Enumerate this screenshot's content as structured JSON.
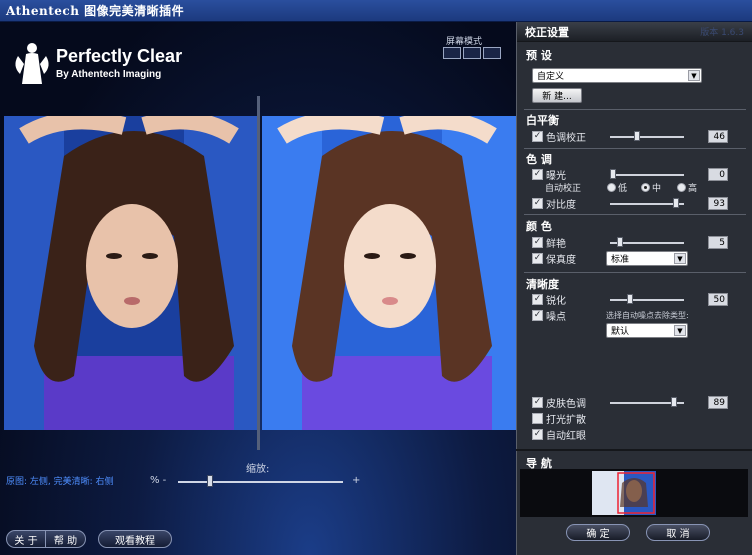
{
  "window": {
    "title": "Athentech  图像完美清晰插件"
  },
  "logo": {
    "brand": "Perfectly Clear",
    "sub": "By Athentech Imaging"
  },
  "screen_mode": {
    "label": "屏幕模式"
  },
  "viewer": {
    "zoom_label": "缩放:",
    "legend": "原图: 左侧, 完美清晰: 右侧",
    "pct_label": "% -",
    "plus_label": "+",
    "zoom_level": 0.18
  },
  "bottom": {
    "about": "关 于",
    "help": "帮 助",
    "tutorial": "观看教程"
  },
  "panel": {
    "header": "校正设置",
    "version": "版本 1.6.3",
    "preset": {
      "title": "预 设",
      "selected": "自定义",
      "new_button": "新 建..."
    },
    "white_balance": {
      "title": "白平衡",
      "color_correction": "色调校正",
      "value": "46",
      "level": 0.35
    },
    "tone": {
      "title": "色 调",
      "exposure": "曝光",
      "exposure_value": "0",
      "exposure_level": 0.0,
      "auto_label": "自动校正",
      "radio_low": "低",
      "radio_mid": "中",
      "radio_high": "高",
      "contrast": "对比度",
      "contrast_value": "93",
      "contrast_level": 0.93
    },
    "color": {
      "title": "颜 色",
      "vividness": "鲜艳",
      "vividness_value": "5",
      "vividness_level": 0.1,
      "fidelity": "保真度",
      "fidelity_selected": "标准"
    },
    "sharpness": {
      "title": "清晰度",
      "sharpen": "锐化",
      "sharpen_value": "50",
      "sharpen_level": 0.25,
      "noise": "噪点",
      "noise_type_label": "选择自动噪点去除类型:",
      "noise_selected": "默认"
    },
    "extra": {
      "skin_tone": "皮肤色调",
      "skin_value": "89",
      "skin_level": 0.89,
      "light_diffusion": "打光扩散",
      "auto_redeye": "自动红眼"
    },
    "navigation": {
      "title": "导 航"
    },
    "ok": "确 定",
    "cancel": "取 消"
  },
  "colors": {
    "accent_blue": "#4f8fff",
    "panel_bg": "#2a2e36",
    "title_bar": "#2a4f9e"
  },
  "icons": {
    "logo": "angel-logo-icon",
    "check": "checkmark-icon"
  }
}
